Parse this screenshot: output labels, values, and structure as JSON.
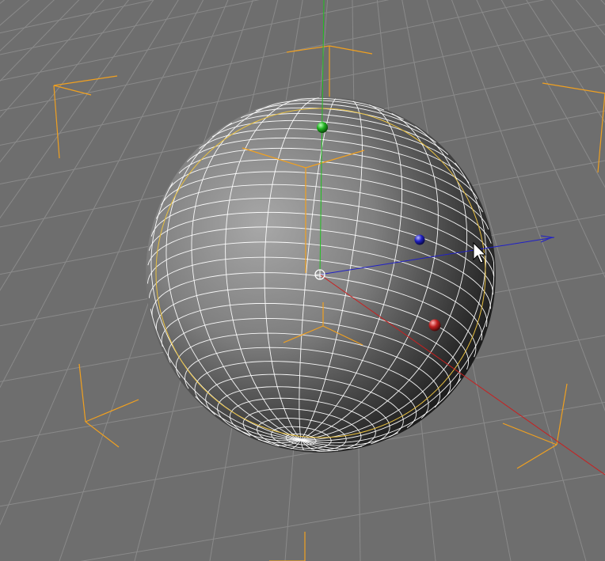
{
  "viewport": {
    "name": "perspective-viewport",
    "background": "#6e6e6e",
    "grid_color": "#8a8a8a",
    "selection_bracket_color": "#f0a020"
  },
  "scene": {
    "object": {
      "name": "sphere",
      "type": "polygon-sphere",
      "display_mode": "gouraud-shading-wireframe",
      "selected": true,
      "wire_color": "#ffffff",
      "bounding_circle_color": "#e8c040"
    }
  },
  "gizmo": {
    "type": "move-tool",
    "axes": [
      {
        "name": "x",
        "color": "#c82020",
        "handle_color": "#d01818"
      },
      {
        "name": "y",
        "color": "#20c020",
        "handle_color": "#18b818"
      },
      {
        "name": "z",
        "color": "#2020c8",
        "handle_color": "#1818d0"
      }
    ],
    "pivot_color": "#ffffff"
  },
  "cursor": {
    "type": "arrow"
  }
}
